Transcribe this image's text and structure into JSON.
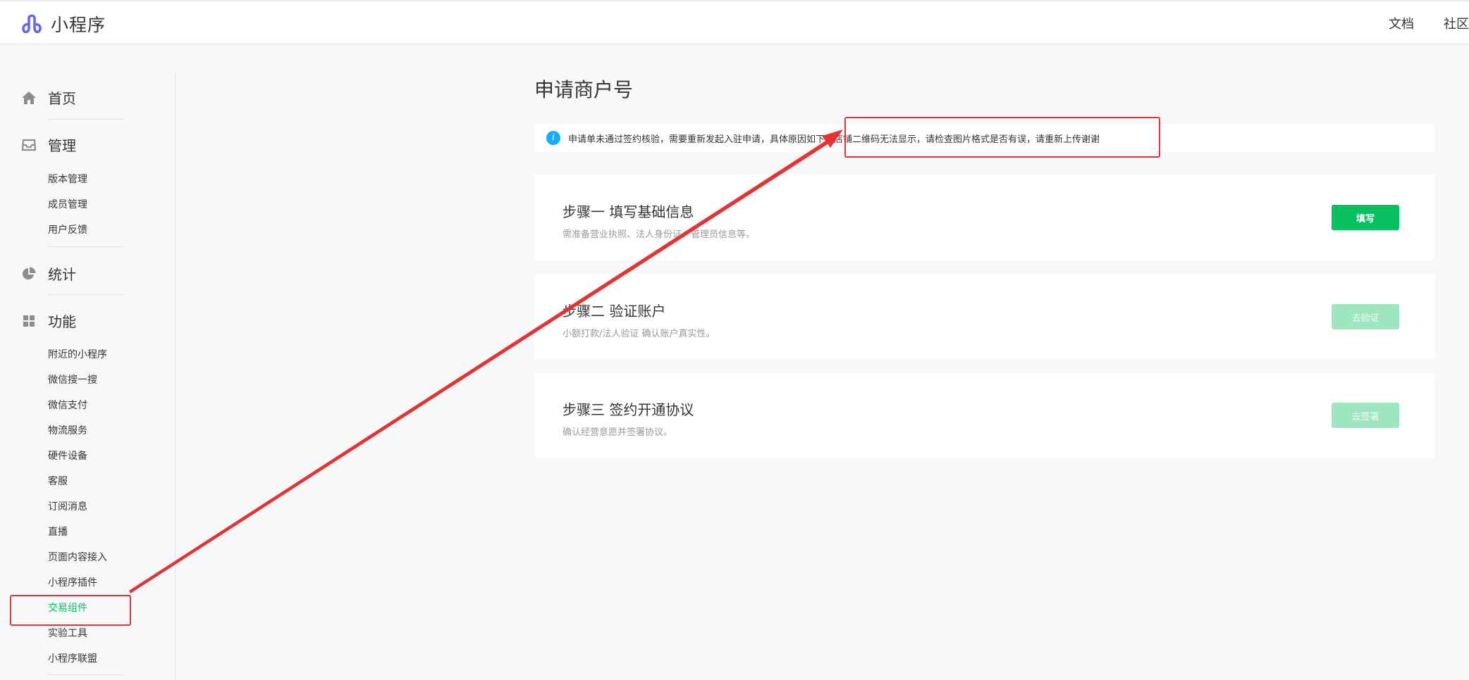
{
  "header": {
    "brand_title": "小程序",
    "links": [
      "文档",
      "社区"
    ]
  },
  "sidebar": {
    "home": {
      "label": "首页",
      "icon": "home-icon"
    },
    "manage": {
      "label": "管理",
      "icon": "inbox-icon",
      "items": [
        "版本管理",
        "成员管理",
        "用户反馈"
      ]
    },
    "stats": {
      "label": "统计",
      "icon": "pie-chart-icon"
    },
    "features": {
      "label": "功能",
      "icon": "grid-icon",
      "items": [
        "附近的小程序",
        "微信搜一搜",
        "微信支付",
        "物流服务",
        "硬件设备",
        "客服",
        "订阅消息",
        "直播",
        "页面内容接入",
        "小程序插件",
        "交易组件",
        "实验工具",
        "小程序联盟"
      ],
      "active_item": "交易组件"
    }
  },
  "main": {
    "title": "申请商户号",
    "notice": "申请单未通过签约核验，需要重新发起入驻申请，具体原因如下：店铺二维码无法显示，请检查图片格式是否有误，请重新上传谢谢",
    "steps": [
      {
        "title": "步骤一 填写基础信息",
        "desc": "需准备营业执照、法人身份证、管理员信息等。",
        "button": "填写",
        "enabled": true
      },
      {
        "title": "步骤二 验证账户",
        "desc": "小额打款/法人验证 确认账户真实性。",
        "button": "去验证",
        "enabled": false
      },
      {
        "title": "步骤三 签约开通协议",
        "desc": "确认经营意愿并签署协议。",
        "button": "去签署",
        "enabled": false
      }
    ]
  },
  "colors": {
    "brand_accent": "#6467f0",
    "primary_green": "#07c160",
    "disabled_green": "#9ee6c0",
    "info_blue": "#10aeff",
    "annotation_red": "#e53333"
  }
}
